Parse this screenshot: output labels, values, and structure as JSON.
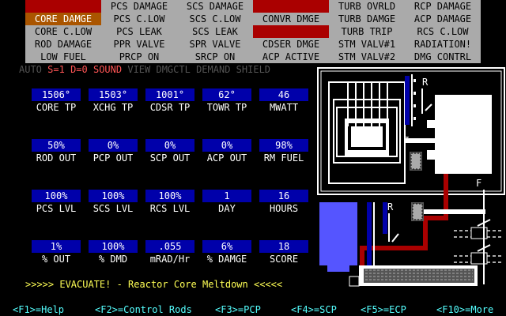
{
  "alarms": [
    [
      {
        "text": "",
        "state": "red"
      },
      {
        "text": "PCS DAMAGE",
        "state": "off"
      },
      {
        "text": "SCS DAMAGE",
        "state": "off"
      },
      {
        "text": "",
        "state": "red"
      },
      {
        "text": "TURB OVRLD",
        "state": "off"
      },
      {
        "text": "RCP DAMAGE",
        "state": "off"
      }
    ],
    [
      {
        "text": "CORE DAMGE",
        "state": "orange"
      },
      {
        "text": "PCS  C.LOW",
        "state": "off"
      },
      {
        "text": "SCS  C.LOW",
        "state": "off"
      },
      {
        "text": "CONVR DMGE",
        "state": "off"
      },
      {
        "text": "TURB DAMGE",
        "state": "off"
      },
      {
        "text": "ACP DAMAGE",
        "state": "off"
      }
    ],
    [
      {
        "text": "CORE C.LOW",
        "state": "off"
      },
      {
        "text": "PCS LEAK",
        "state": "off"
      },
      {
        "text": "SCS LEAK",
        "state": "off"
      },
      {
        "text": "",
        "state": "red"
      },
      {
        "text": "TURB  TRIP",
        "state": "off"
      },
      {
        "text": "RCS  C.LOW",
        "state": "off"
      }
    ],
    [
      {
        "text": "ROD DAMAGE",
        "state": "off"
      },
      {
        "text": "PPR  VALVE",
        "state": "off"
      },
      {
        "text": "SPR  VALVE",
        "state": "off"
      },
      {
        "text": "CDSER DMGE",
        "state": "off"
      },
      {
        "text": "STM VALV#1",
        "state": "off"
      },
      {
        "text": "RADIATION!",
        "state": "off"
      }
    ],
    [
      {
        "text": "LOW FUEL",
        "state": "off"
      },
      {
        "text": "PRCP   ON",
        "state": "off"
      },
      {
        "text": "SRCP   ON",
        "state": "off"
      },
      {
        "text": "ACP ACTIVE",
        "state": "off"
      },
      {
        "text": "STM VALV#2",
        "state": "off"
      },
      {
        "text": "DMG CONTRL",
        "state": "off"
      }
    ]
  ],
  "mode_bar": {
    "auto": "AUTO",
    "s": "S=1",
    "d": "D=0",
    "sound": "SOUND",
    "view": "VIEW",
    "dmgctl": "DMGCTL",
    "demand": "DEMAND",
    "shield": "SHIELD"
  },
  "gauges": [
    [
      {
        "value": "1506°",
        "label": "CORE TP"
      },
      {
        "value": "1503°",
        "label": "XCHG TP"
      },
      {
        "value": "1001°",
        "label": "CDSR TP"
      },
      {
        "value": "62°",
        "label": "TOWR TP"
      },
      {
        "value": "46",
        "label": "MWATT"
      }
    ],
    [
      {
        "value": "50%",
        "label": "ROD OUT"
      },
      {
        "value": "0%",
        "label": "PCP OUT"
      },
      {
        "value": "0%",
        "label": "SCP OUT"
      },
      {
        "value": "0%",
        "label": "ACP OUT"
      },
      {
        "value": "98%",
        "label": "RM FUEL"
      }
    ],
    [
      {
        "value": "100%",
        "label": "PCS LVL"
      },
      {
        "value": "100%",
        "label": "SCS LVL"
      },
      {
        "value": "100%",
        "label": "RCS LVL"
      },
      {
        "value": "1",
        "label": "DAY"
      },
      {
        "value": "16",
        "label": "HOURS"
      }
    ],
    [
      {
        "value": "1%",
        "label": "% OUT"
      },
      {
        "value": "100%",
        "label": "% DMD"
      },
      {
        "value": ".055",
        "label": "mRAD/Hr"
      },
      {
        "value": "6%",
        "label": "% DAMGE"
      },
      {
        "value": "18",
        "label": "SCORE"
      }
    ]
  ],
  "status_message": ">>>>> EVACUATE! - Reactor Core Meltdown <<<<<",
  "function_keys": [
    {
      "label": "<F1>=Help"
    },
    {
      "label": "<F2>=Control Rods"
    },
    {
      "label": "<F3>=PCP"
    },
    {
      "label": "<F4>=SCP"
    },
    {
      "label": "<F5>=ECP"
    },
    {
      "label": "<F10>=More"
    }
  ],
  "colors": {
    "panel_gray": "#aaaaaa",
    "alarm_red": "#aa0000",
    "alarm_orange": "#aa5500",
    "gauge_blue": "#0000aa",
    "mode_gray": "#555555",
    "mode_red": "#ff5555",
    "yellow": "#ffff55",
    "cyan": "#55ffff",
    "pipe_red": "#aa0000",
    "tank_blue": "#5555ff"
  },
  "diagram_labels": {
    "r1": "R",
    "r2": "R",
    "f": "F",
    "i": "I"
  }
}
